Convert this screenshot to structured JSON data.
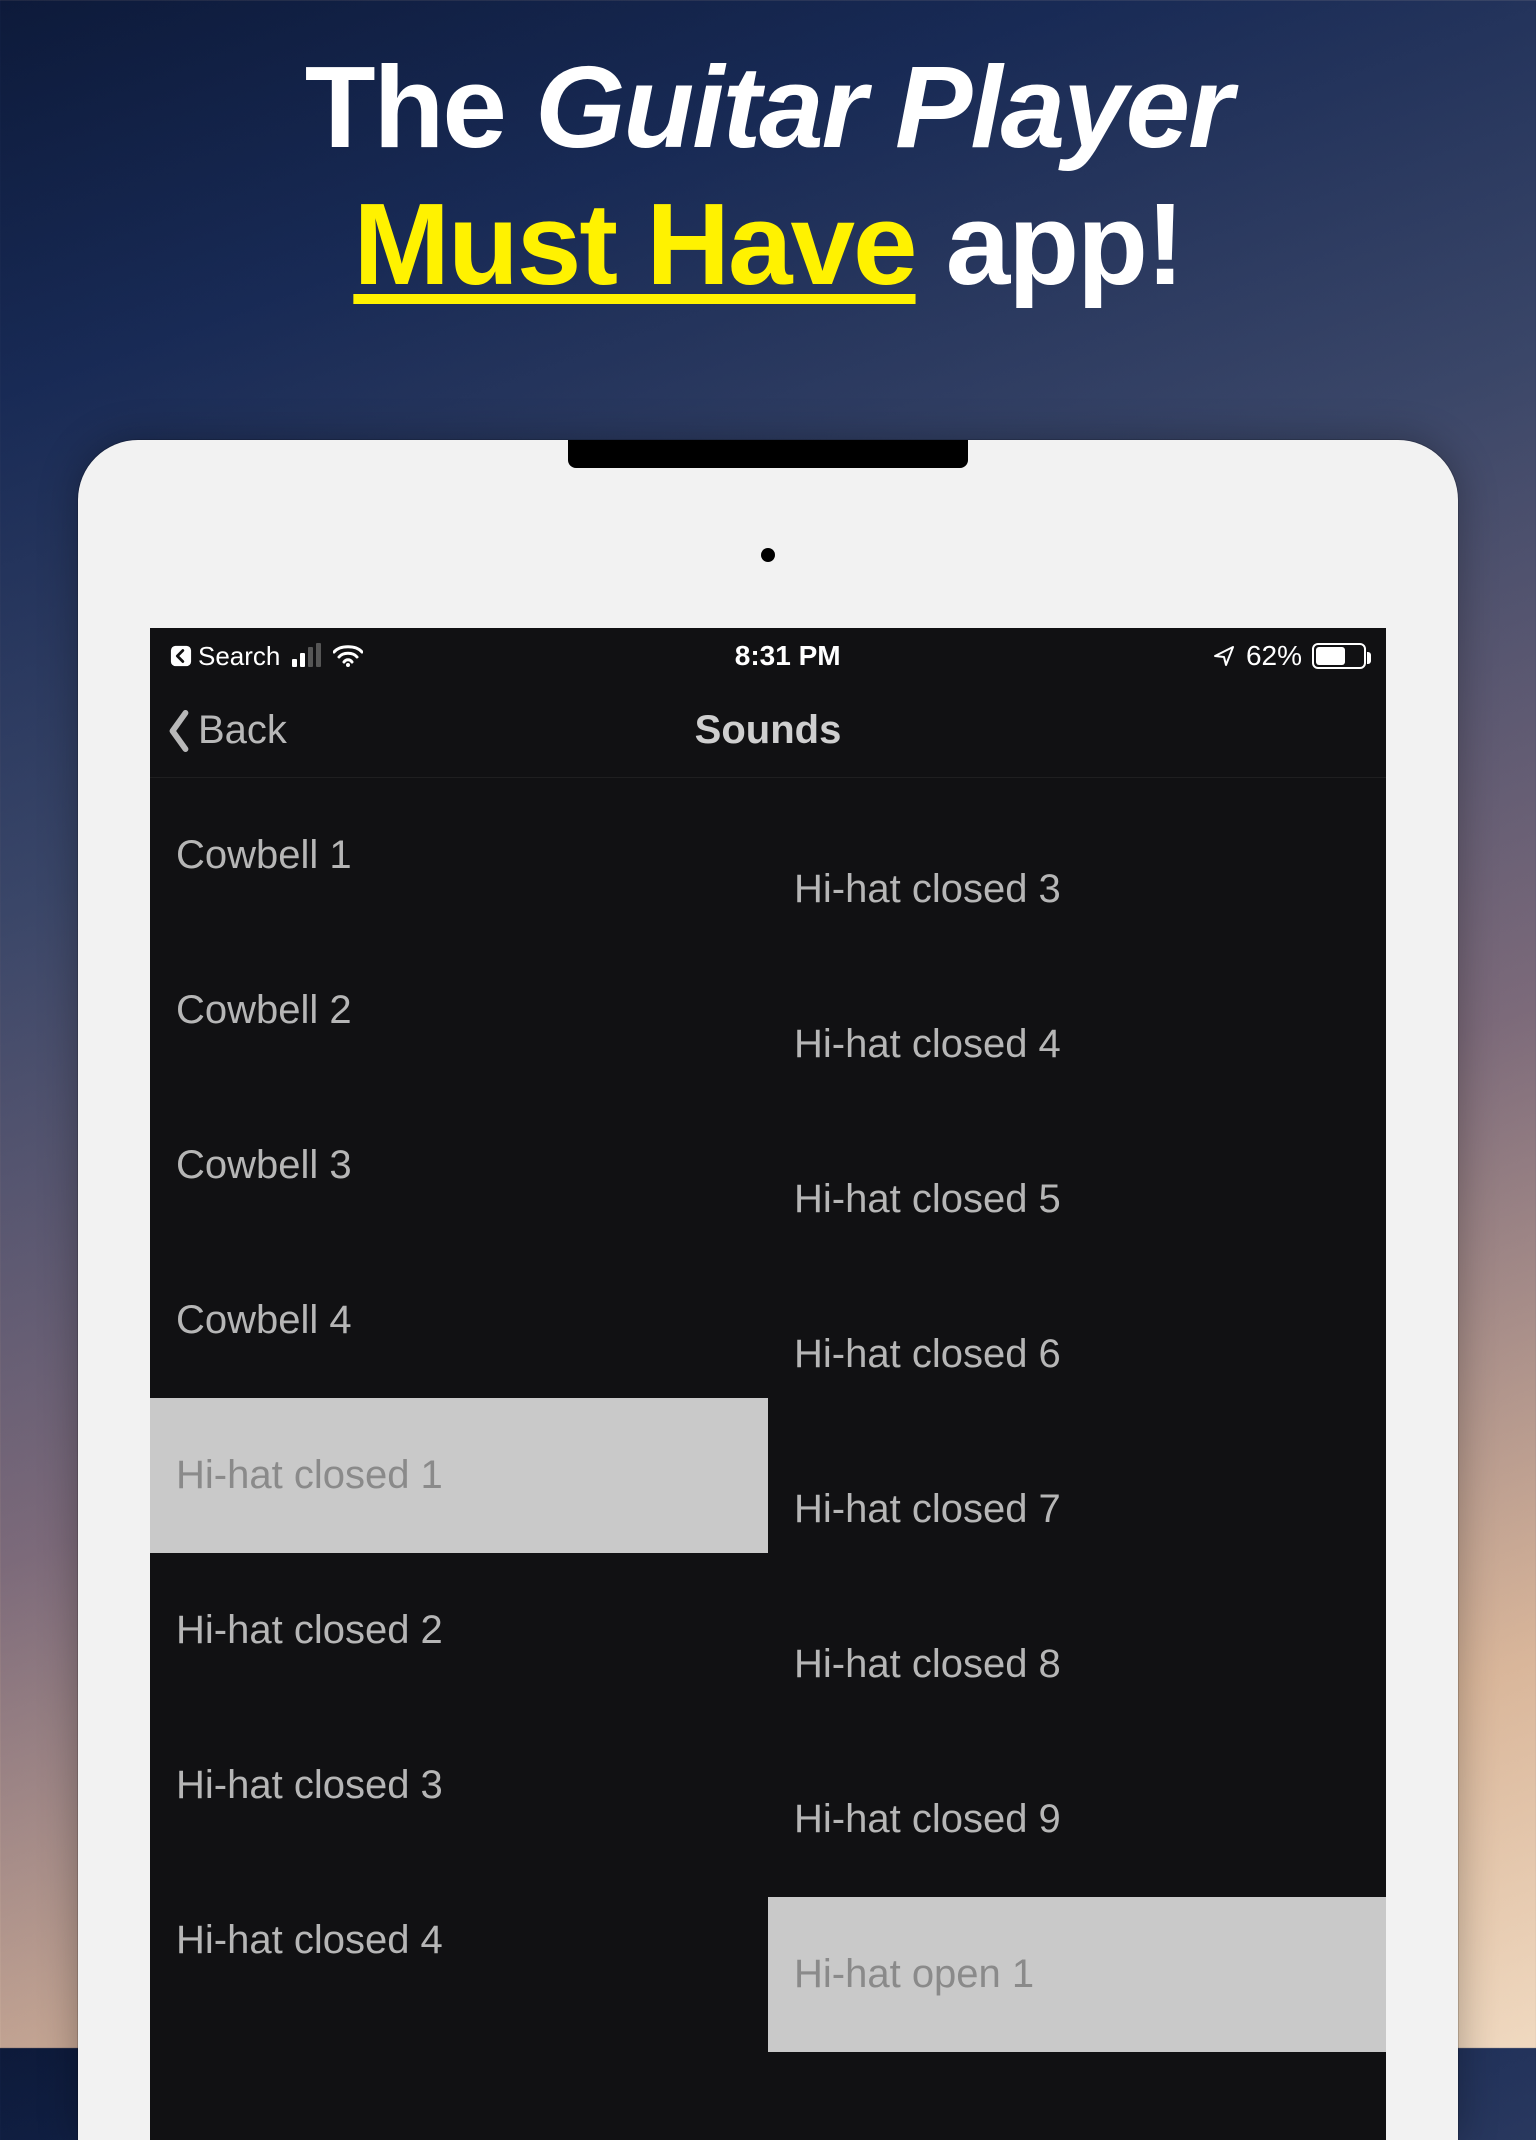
{
  "headline": {
    "prefix": "The ",
    "italic": "Guitar Player",
    "must_have": "Must Have",
    "suffix": " app!"
  },
  "status": {
    "search_label": "Search",
    "time": "8:31 PM",
    "battery_pct": "62%"
  },
  "nav": {
    "back_label": "Back",
    "title": "Sounds"
  },
  "columns": {
    "left": [
      {
        "label": "Cowbell 1",
        "selected": false
      },
      {
        "label": "Cowbell 2",
        "selected": false
      },
      {
        "label": "Cowbell 3",
        "selected": false
      },
      {
        "label": "Cowbell 4",
        "selected": false
      },
      {
        "label": "Hi-hat closed 1",
        "selected": true
      },
      {
        "label": "Hi-hat closed 2",
        "selected": false
      },
      {
        "label": "Hi-hat closed 3",
        "selected": false
      },
      {
        "label": "Hi-hat closed 4",
        "selected": false
      }
    ],
    "right": [
      {
        "label": "Hi-hat closed 3",
        "selected": false
      },
      {
        "label": "Hi-hat closed 4",
        "selected": false
      },
      {
        "label": "Hi-hat closed 5",
        "selected": false
      },
      {
        "label": "Hi-hat closed 6",
        "selected": false
      },
      {
        "label": "Hi-hat closed 7",
        "selected": false
      },
      {
        "label": "Hi-hat closed 8",
        "selected": false
      },
      {
        "label": "Hi-hat closed 9",
        "selected": false
      },
      {
        "label": "Hi-hat open 1",
        "selected": true
      }
    ]
  }
}
